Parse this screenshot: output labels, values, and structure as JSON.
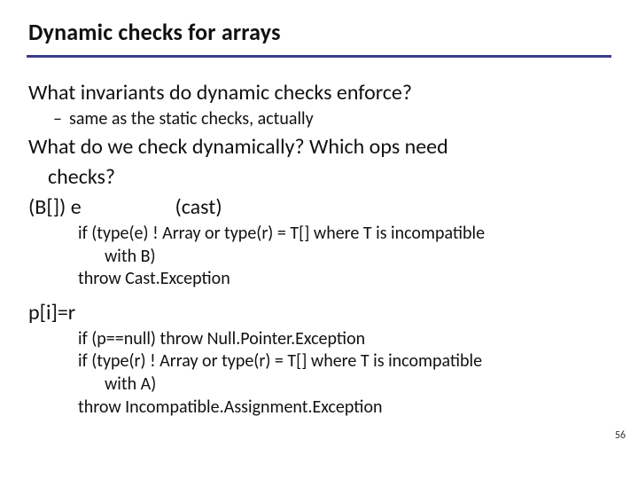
{
  "title": "Dynamic checks for arrays",
  "q1": "What invariants do dynamic checks enforce?",
  "q1_sub_dash": "–",
  "q1_sub": "same as the static checks, actually",
  "q2a": "What do we check dynamically?  Which ops need",
  "q2b": "checks?",
  "row1_left": "(B[]) e",
  "row1_right": "(cast)",
  "code1_l1": "if (type(e) ! Array or type(r) = T[] where T is incompatible",
  "code1_l1b": "with B)",
  "code1_l2": "throw Cast.Exception",
  "row2": "p[i]=r",
  "code2_l1": "if (p==null)   throw Null.Pointer.Exception",
  "code2_l2": "if (type(r) ! Array or type(r) = T[] where T is incompatible",
  "code2_l2b": "with A)",
  "code2_l3": "throw Incompatible.Assignment.Exception",
  "pageno": "56"
}
